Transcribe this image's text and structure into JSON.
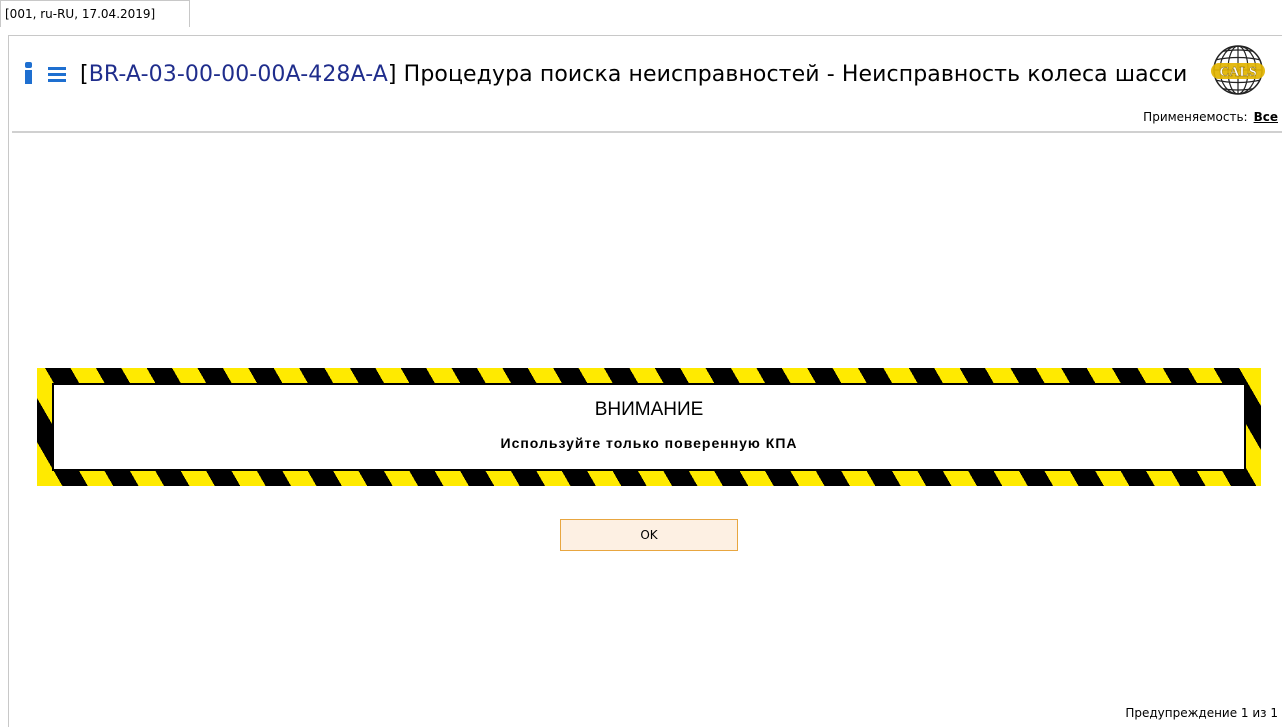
{
  "tab": {
    "label": "[001, ru-RU, 17.04.2019]"
  },
  "header": {
    "bracket_open": "[",
    "doc_code": "BR-A-03-00-00-00A-428A-A",
    "bracket_close": "]",
    "title": " Процедура поиска неисправностей - Неисправность колеса шасси"
  },
  "applicability": {
    "label": "Применяемость:",
    "value": "Все"
  },
  "warning": {
    "title": "ВНИМАНИЕ",
    "text": "Используйте только поверенную КПА"
  },
  "buttons": {
    "ok_label": "OK"
  },
  "footer": {
    "status": "Предупреждение 1 из 1"
  },
  "colors": {
    "accent": "#1e6fd0",
    "doc_code": "#1f2d8c",
    "stripe_yellow": "#ffea00",
    "stripe_black": "#000000",
    "button_bg": "#fdf0e3",
    "button_border": "#e8a640"
  },
  "icons": [
    "info-icon",
    "menu-icon",
    "cals-globe-logo"
  ]
}
